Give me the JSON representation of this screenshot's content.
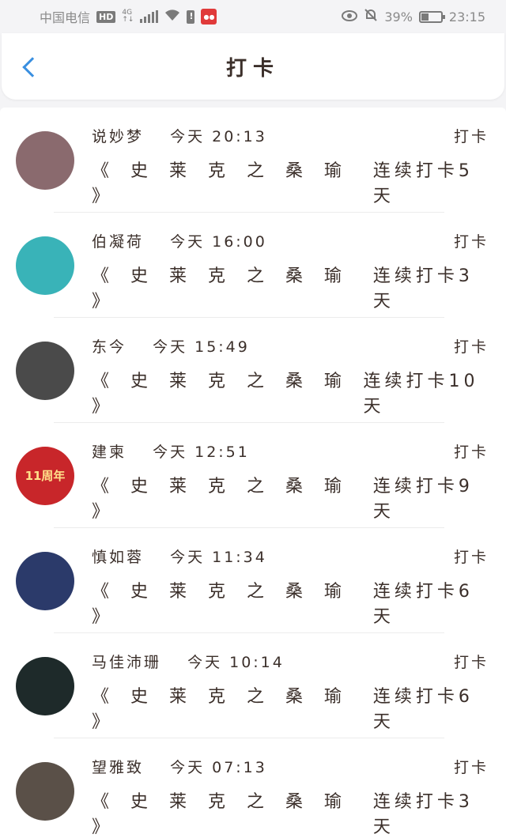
{
  "status_bar": {
    "carrier": "中国电信",
    "hd": "HD",
    "network_top": "4G",
    "network_bottom": "↑↓",
    "battery_percent": "39%",
    "time": "23:15",
    "battery_level": 0.39
  },
  "header": {
    "title": "打卡"
  },
  "items": [
    {
      "name": "说妙梦",
      "time": "今天 20:13",
      "action": "打卡",
      "book": "《 史 莱 克 之 桑 瑜 》",
      "streak": "连续打卡5天",
      "avatar_color": "#8a6a6e"
    },
    {
      "name": "伯凝荷",
      "time": "今天 16:00",
      "action": "打卡",
      "book": "《 史 莱 克 之 桑 瑜 》",
      "streak": "连续打卡3天",
      "avatar_color": "#39b3b8"
    },
    {
      "name": "东今",
      "time": "今天 15:49",
      "action": "打卡",
      "book": "《 史 莱 克 之 桑 瑜 》",
      "streak": "连续打卡10天",
      "avatar_color": "#4a4a4a"
    },
    {
      "name": "建柬",
      "time": "今天 12:51",
      "action": "打卡",
      "book": "《 史 莱 克 之 桑 瑜 》",
      "streak": "连续打卡9天",
      "avatar_color": "#c8262a",
      "avatar_text": "11周年"
    },
    {
      "name": "慎如蓉",
      "time": "今天 11:34",
      "action": "打卡",
      "book": "《 史 莱 克 之 桑 瑜 》",
      "streak": "连续打卡6天",
      "avatar_color": "#2b3a6a"
    },
    {
      "name": "马佳沛珊",
      "time": "今天 10:14",
      "action": "打卡",
      "book": "《 史 莱 克 之 桑 瑜 》",
      "streak": "连续打卡6天",
      "avatar_color": "#1e2a2a"
    },
    {
      "name": "望雅致",
      "time": "今天 07:13",
      "action": "打卡",
      "book": "《 史 莱 克 之 桑 瑜 》",
      "streak": "连续打卡3天",
      "avatar_color": "#5a5048"
    }
  ]
}
